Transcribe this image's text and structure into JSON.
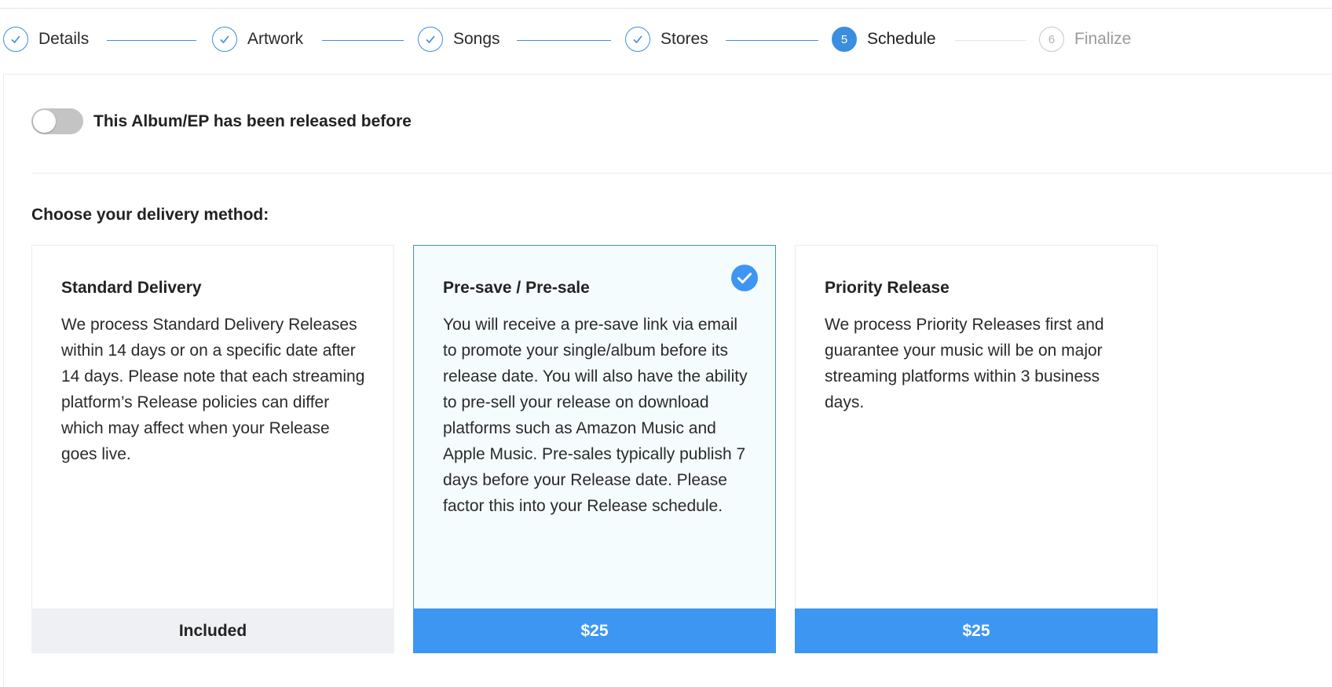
{
  "stepper": {
    "steps": [
      {
        "label": "Details",
        "state": "done",
        "number": "1"
      },
      {
        "label": "Artwork",
        "state": "done",
        "number": "2"
      },
      {
        "label": "Songs",
        "state": "done",
        "number": "3"
      },
      {
        "label": "Stores",
        "state": "done",
        "number": "4"
      },
      {
        "label": "Schedule",
        "state": "active",
        "number": "5"
      },
      {
        "label": "Finalize",
        "state": "pending",
        "number": "6"
      }
    ]
  },
  "release_toggle": {
    "label": "This Album/EP has been released before",
    "checked": false
  },
  "delivery": {
    "title": "Choose your delivery method:",
    "options": [
      {
        "title": "Standard Delivery",
        "description": "We process Standard Delivery Releases within 14 days or on a specific date after 14 days. Please note that each streaming platform’s Release policies can differ which may affect when your Release goes live.",
        "price": "Included",
        "selected": false
      },
      {
        "title": "Pre-save / Pre-sale",
        "description": "You will receive a pre-save link via email to promote your single/album before its release date. You will also have the ability to pre-sell your release on download platforms such as Amazon Music and Apple Music. Pre-sales typically publish 7 days before your Release date. Please factor this into your Release schedule.",
        "price": "$25",
        "selected": true
      },
      {
        "title": "Priority Release",
        "description": "We process Priority Releases first and guarantee your music will be on major streaming platforms within 3 business days.",
        "price": "$25",
        "selected": false
      }
    ]
  },
  "colors": {
    "accent": "#3b8ede",
    "price_button": "#3d96f2",
    "included_bg": "#eff0f3",
    "selected_card_bg": "#f5fcfd"
  }
}
